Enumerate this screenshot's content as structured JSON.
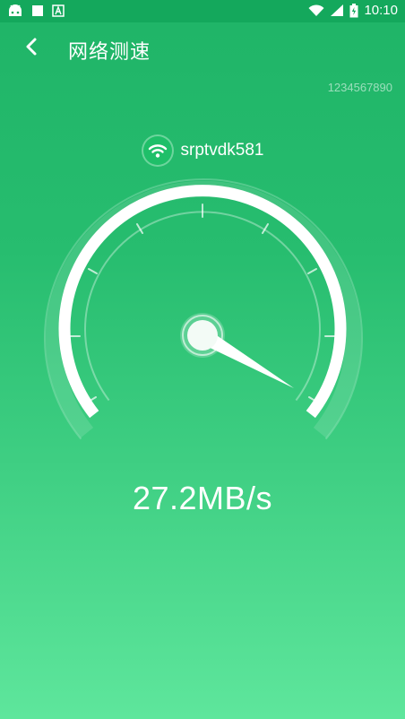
{
  "status_bar": {
    "time": "10:10",
    "left_icons": [
      "android-icon",
      "square-notification-icon",
      "a-notification-icon"
    ],
    "right_icons": [
      "wifi-icon",
      "signal-icon",
      "battery-icon"
    ]
  },
  "header": {
    "back_icon": "chevron-left-icon",
    "title": "网络测速"
  },
  "device_id": "1234567890",
  "network": {
    "icon": "wifi-icon",
    "ssid": "srptvdk581"
  },
  "speed": {
    "value_text": "27.2MB/s"
  },
  "colors": {
    "top": "#1fb467",
    "bottom": "#5ee69c",
    "status_bar": "#14a85c"
  }
}
